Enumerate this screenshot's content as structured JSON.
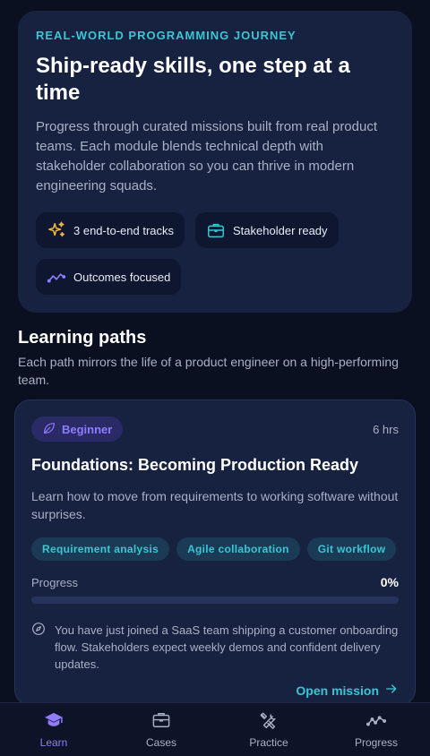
{
  "hero": {
    "eyebrow": "REAL-WORLD PROGRAMMING JOURNEY",
    "title": "Ship-ready skills, one step at a time",
    "description": "Progress through curated missions built from real product teams. Each module blends technical depth with stakeholder collaboration so you can thrive in modern engineering squads.",
    "chips": [
      {
        "icon": "sparkles-icon",
        "label": "3 end-to-end tracks"
      },
      {
        "icon": "briefcase-icon",
        "label": "Stakeholder ready"
      },
      {
        "icon": "trend-line-icon",
        "label": "Outcomes focused"
      }
    ]
  },
  "learning_paths": {
    "title": "Learning paths",
    "subtitle": "Each path mirrors the life of a product engineer on a high-performing team."
  },
  "path_card": {
    "level": "Beginner",
    "level_icon": "leaf-icon",
    "duration": "6 hrs",
    "title": "Foundations: Becoming Production Ready",
    "description": "Learn how to move from requirements to working software without surprises.",
    "tags": [
      "Requirement analysis",
      "Agile collaboration",
      "Git workflow"
    ],
    "progress_label": "Progress",
    "progress_value": "0%",
    "progress_fraction": 0,
    "scenario_icon": "compass-icon",
    "scenario": "You have just joined a SaaS team shipping a customer onboarding flow. Stakeholders expect weekly demos and confident delivery updates.",
    "cta": "Open mission"
  },
  "nav": {
    "items": [
      {
        "label": "Learn",
        "icon": "graduation-cap-icon",
        "active": true
      },
      {
        "label": "Cases",
        "icon": "briefcase-icon",
        "active": false
      },
      {
        "label": "Practice",
        "icon": "tools-icon",
        "active": false
      },
      {
        "label": "Progress",
        "icon": "trend-line-icon",
        "active": false
      }
    ]
  },
  "colors": {
    "background": "#0b1020",
    "card": "#172140",
    "accent_cyan": "#38c7d3",
    "accent_violet": "#8f7cff",
    "sparkle_gold": "#f5b942"
  }
}
